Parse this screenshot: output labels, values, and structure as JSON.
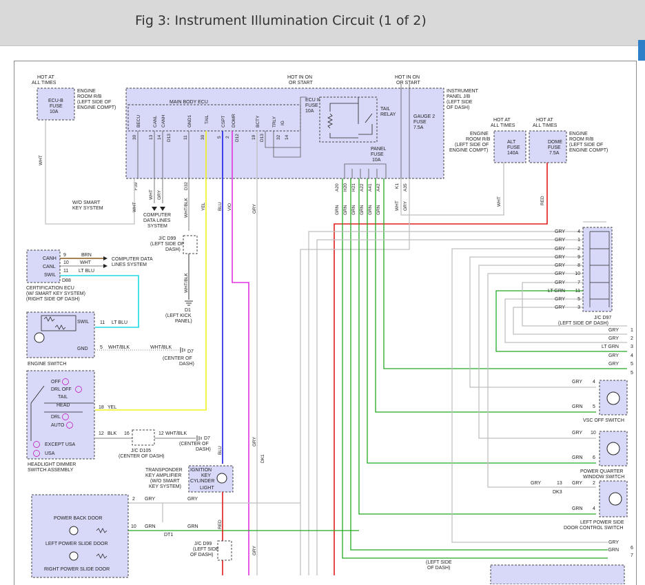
{
  "page": {
    "title": "Fig 3: Instrument Illumination Circuit (1 of 2)"
  },
  "power": {
    "hot_always_1": [
      "HOT AT",
      "ALL TIMES"
    ],
    "hot_ign_1": [
      "HOT IN ON",
      "OR START"
    ],
    "hot_ign_2": [
      "HOT IN ON",
      "OR START"
    ],
    "hot_always_2": [
      "HOT AT",
      "ALL TIMES"
    ],
    "hot_always_3": [
      "HOT AT",
      "ALL TIMES"
    ]
  },
  "engine_rb": [
    "ENGINE",
    "ROOM R/B",
    "(LEFT SIDE OF",
    "ENGINE COMPT)"
  ],
  "ecub_fuse": [
    "ECU-B",
    "FUSE",
    "10A"
  ],
  "ecuig1_fuse": [
    "ECU IG 1",
    "FUSE",
    "10A"
  ],
  "main_body_ecu": "MAIN BODY ECU",
  "ecu_pins": [
    "BECU",
    "CANL",
    "CANH",
    "GND1",
    "TAIL",
    "CSPT",
    "DOMR",
    "BCTY",
    "TRLY",
    "IG"
  ],
  "ecu_pin_nums": [
    "30",
    "13",
    "14",
    "D13",
    "11",
    "30",
    "5",
    "2",
    "D12",
    "19",
    "D13",
    "32",
    "14"
  ],
  "tail_relay": [
    "TAIL",
    "RELAY"
  ],
  "panel_fuse": [
    "PANEL",
    "FUSE",
    "10A"
  ],
  "gauge2_fuse": [
    "GAUGE 2",
    "FUSE",
    "7.5A"
  ],
  "instrument_jb": [
    "INSTRUMENT",
    "PANEL J/B",
    "(LEFT SIDE",
    "OF DASH)"
  ],
  "alt_fuse": [
    "ALT",
    "FUSE",
    "140A"
  ],
  "dome_fuse": [
    "DOME",
    "FUSE",
    "7.5A"
  ],
  "engine_rb_2": [
    "ENGINE",
    "ROOM R/B",
    "(LEFT SIDE OF",
    "ENGINE COMPT)"
  ],
  "engine_rb_3": [
    "ENGINE",
    "ROOM R/B",
    "(LEFT SIDE OF",
    "ENGINE COMPT)"
  ],
  "jb_pins": [
    "A20",
    "H20",
    "H21",
    "A22",
    "A41",
    "A42",
    "K1",
    "A35"
  ],
  "ecu_conn": [
    "F39",
    "D32"
  ],
  "wire_colors": {
    "wht": "WHT",
    "gry": "GRY",
    "whtblk": "WHT/BLK",
    "yel": "YEL",
    "blu": "BLU",
    "vio": "VIO",
    "grn": "GRN",
    "red": "RED",
    "brn": "BRN",
    "ltblu": "LT BLU",
    "blk": "BLK",
    "ltgrn": "LT GRN"
  },
  "smart_key": [
    "W/O SMART",
    "KEY SYSTEM"
  ],
  "computer_data": [
    "COMPUTER",
    "DATA LINES",
    "SYSTEM"
  ],
  "jc_d99": [
    "J/C D99",
    "(LEFT SIDE OF",
    "DASH)"
  ],
  "cert_ecu": {
    "pins": [
      "CANH",
      "CANL",
      "SWIL"
    ],
    "nums": [
      "9",
      "10",
      "11"
    ],
    "conn": "D88",
    "name": [
      "CERTIFICATION ECU",
      "(W/ SMART KEY SYSTEM)",
      "(RIGHT SIDE OF DASH)"
    ],
    "to": [
      "COMPUTER DATA",
      "LINES SYSTEM"
    ]
  },
  "d1": [
    "D1",
    "(LEFT KICK",
    "PANEL)"
  ],
  "engine_switch": {
    "swil": "SWIL",
    "gnd": "GND",
    "name": "ENGINE SWITCH",
    "n1": "11",
    "n2": "5"
  },
  "d7_a": [
    "D7",
    "(CENTER OF",
    "DASH)"
  ],
  "headlight_sw": {
    "items": [
      "OFF",
      "DRL OFF",
      "TAIL",
      "HEAD",
      "DRL",
      "AUTO"
    ],
    "legend": [
      "EXCEPT USA",
      "USA"
    ],
    "name": [
      "HEADLIGHT DIMMER",
      "SWITCH ASSEMBLY"
    ],
    "n18": "18",
    "n12": "12"
  },
  "jc_d105": [
    "J/C D105",
    "(CENTER OF DASH)"
  ],
  "d7_b": [
    "D7",
    "(CENTER OF",
    "DASH)"
  ],
  "transponder": [
    "TRANSPONDER",
    "KEY AMPLIFIER",
    "(W/O SMART",
    "KEY SYSTEM)"
  ],
  "ign_light": [
    "IGNITION",
    "KEY",
    "CYLINDER",
    "LIGHT"
  ],
  "dk1": "DK1",
  "power_doors": [
    "POWER BACK DOOR",
    "LEFT POWER SLIDE DOOR",
    "RIGHT POWER SLIDE DOOR"
  ],
  "dt1": "DT1",
  "jc_d99_b": [
    "J/C D99",
    "(LEFT SIDE",
    "OF DASH)"
  ],
  "left_side_dash": [
    "(LEFT SIDE",
    "OF DASH)"
  ],
  "jc_d97": {
    "rows": [
      [
        "GRY",
        "4"
      ],
      [
        "GRY",
        "1"
      ],
      [
        "GRY",
        "2"
      ],
      [
        "GRY",
        "9"
      ],
      [
        "GRY",
        "8"
      ],
      [
        "GRY",
        "10"
      ],
      [
        "GRY",
        "7"
      ],
      [
        "LT GRN",
        "11"
      ],
      [
        "GRY",
        "5"
      ],
      [
        "GRY",
        "3"
      ]
    ],
    "name": [
      "J/C D97",
      "(LEFT SIDE OF DASH)"
    ],
    "out": [
      [
        "GRY",
        "1"
      ],
      [
        "GRY",
        "2"
      ],
      [
        "LT GRN",
        "3"
      ],
      [
        "GRY",
        "4"
      ],
      [
        "GRY",
        "5"
      ]
    ]
  },
  "vsc_sw": {
    "name": "VSC OFF SWITCH",
    "gry": "GRY",
    "grn": "GRN",
    "p1": "4",
    "p2": "5"
  },
  "pq_sw": {
    "name": [
      "POWER QUARTER",
      "WINDOW SWITCH"
    ],
    "gry": "GRY",
    "grn": "GRN",
    "p1": "10",
    "p2": "6"
  },
  "lps_sw": {
    "name": [
      "LEFT POWER SIDE",
      "DOOR CONTROL SWITCH"
    ],
    "gry": "GRY",
    "grn": "GRN",
    "p1": "2",
    "p2": "4",
    "n13": "13",
    "dk3": "DK3"
  },
  "bottom_out": [
    [
      "GRY",
      "6"
    ],
    [
      "GRN",
      "7"
    ]
  ],
  "colors": {
    "yel": "#f2f21a",
    "blu": "#1a1ae6",
    "vio": "#e033e0",
    "grn": "#1faa1f",
    "red": "#e01a1a",
    "ltblu": "#1ad9e6",
    "gry": "#bfbfbf",
    "brn": "#8a5a1a",
    "box": "#d8d8f8"
  }
}
